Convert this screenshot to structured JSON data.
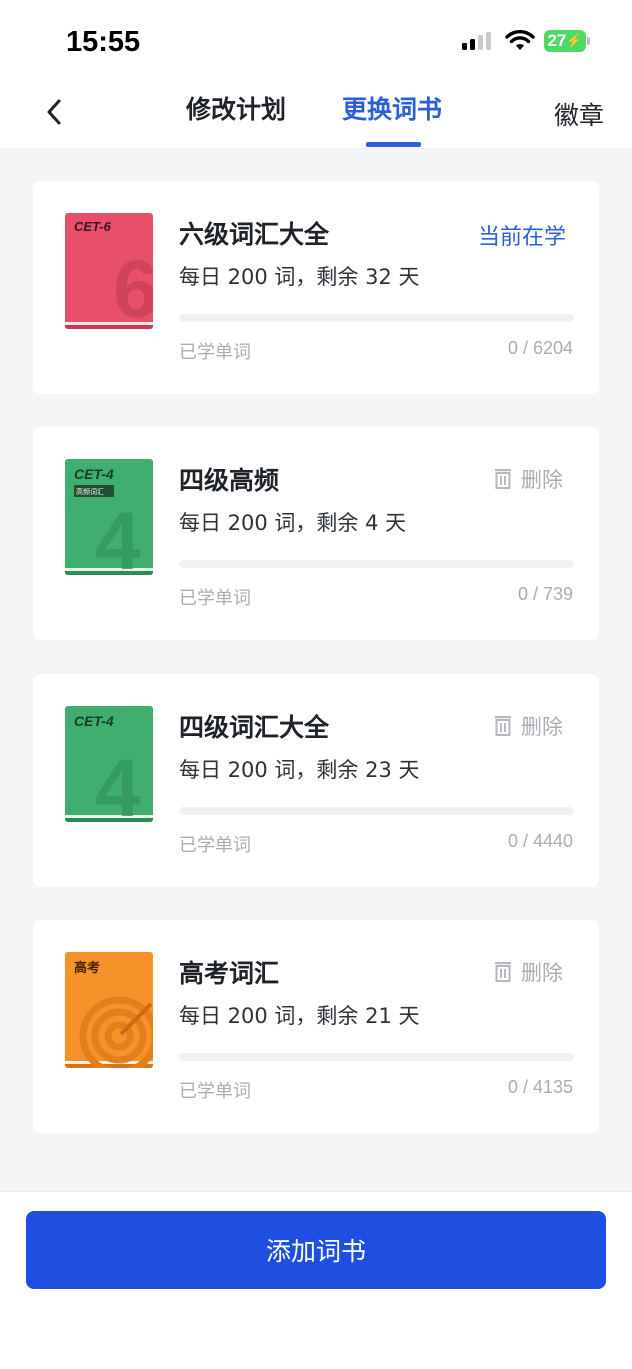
{
  "status_bar": {
    "time": "15:55",
    "battery": "27"
  },
  "nav": {
    "tabs": [
      {
        "label": "修改计划",
        "active": false
      },
      {
        "label": "更换词书",
        "active": true
      }
    ],
    "badge_label": "徽章",
    "back_icon": "chevron-left-icon"
  },
  "books": [
    {
      "cover_label": "CET-6",
      "cover_digit": "6",
      "cover_color": "#e8506a",
      "title": "六级词汇大全",
      "plan": "每日 200 词，剩余 32 天",
      "status": "当前在学",
      "learned_label": "已学单词",
      "learned_count": "0 / 6204",
      "progress": 0
    },
    {
      "cover_label": "CET-4",
      "cover_sublabel": "高频词汇",
      "cover_digit": "4",
      "cover_color": "#3fae6e",
      "title": "四级高频",
      "plan": "每日 200 词，剩余 4  天",
      "delete_label": "删除",
      "learned_label": "已学单词",
      "learned_count": "0 / 739",
      "progress": 0
    },
    {
      "cover_label": "CET-4",
      "cover_digit": "4",
      "cover_color": "#3fae6e",
      "title": "四级词汇大全",
      "plan": "每日 200 词，剩余 23 天",
      "delete_label": "删除",
      "learned_label": "已学单词",
      "learned_count": "0 / 4440",
      "progress": 0
    },
    {
      "cover_label": "高考",
      "cover_color": "#f5922a",
      "title": "高考词汇",
      "plan": "每日 200 词，剩余 21 天",
      "delete_label": "删除",
      "learned_label": "已学单词",
      "learned_count": "0 / 4135",
      "progress": 0
    }
  ],
  "add_button_label": "添加词书",
  "colors": {
    "accent": "#2b5fd9",
    "button": "#1f4fe0"
  }
}
